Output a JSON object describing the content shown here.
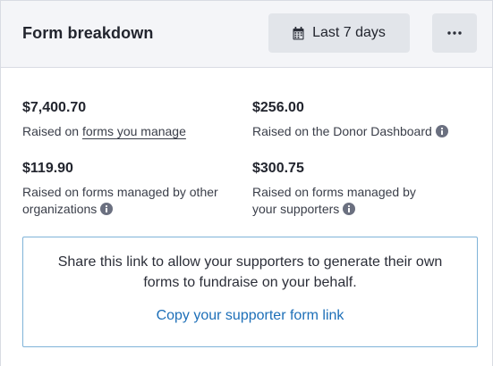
{
  "header": {
    "title": "Form breakdown",
    "date_range_label": "Last 7 days",
    "more_icon": "ellipsis-icon",
    "date_icon": "calendar-icon"
  },
  "stats": [
    {
      "amount": "$7,400.70",
      "label_prefix": "Raised on ",
      "label_link": "forms you manage"
    },
    {
      "amount": "$256.00",
      "label": "Raised on the Donor Dashboard",
      "info": true
    },
    {
      "amount": "$119.90",
      "label_line1": "Raised on forms managed by other",
      "label_line2": "organizations",
      "info": true
    },
    {
      "amount": "$300.75",
      "label_line1": "Raised on forms managed by",
      "label_line2": "your supporters",
      "info": true
    }
  ],
  "share": {
    "text_line1": "Share this link to allow your supporters to generate their own",
    "text_line2": "forms to fundraise on your behalf.",
    "link_label": "Copy your supporter form link"
  },
  "colors": {
    "header_bg": "#f4f5f8",
    "button_bg": "#e2e5ea",
    "link": "#1d6fb8",
    "box_border": "#7fb3d8"
  }
}
